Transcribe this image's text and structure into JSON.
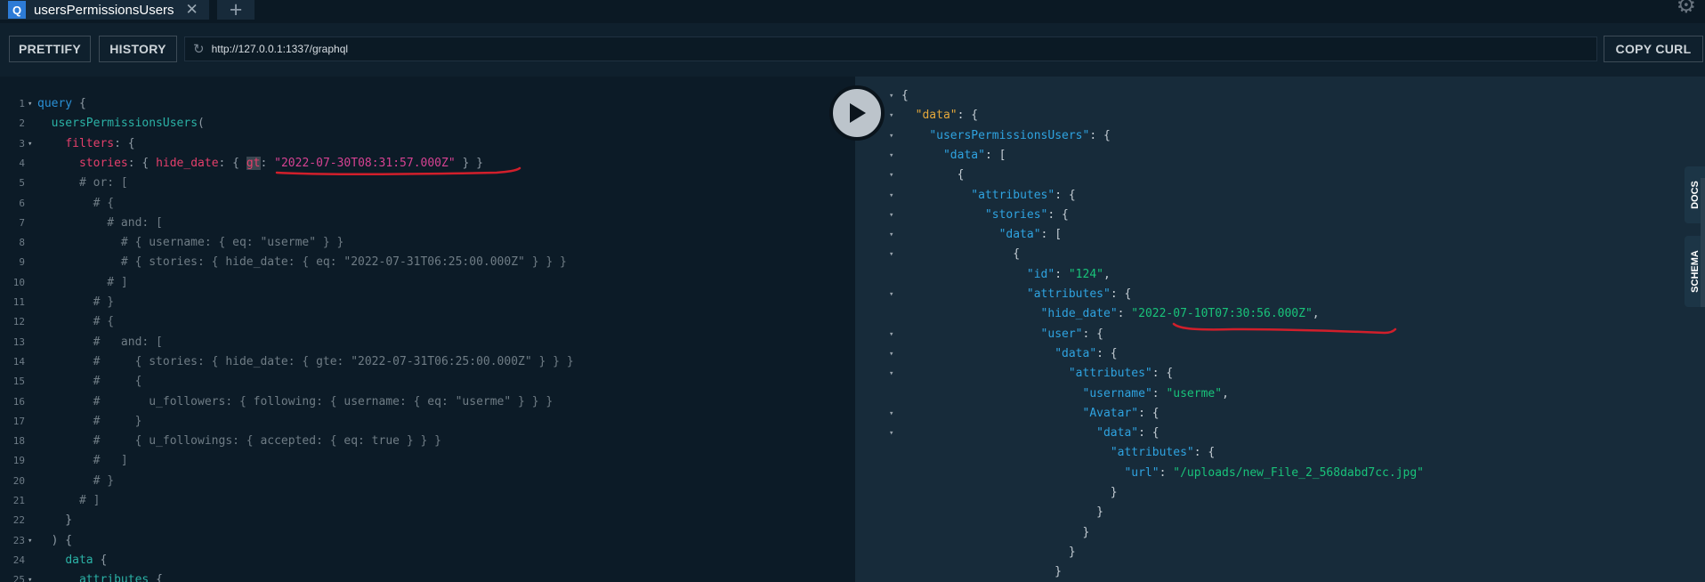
{
  "tab": {
    "icon_letter": "Q",
    "title": "usersPermissionsUsers",
    "close": "✕",
    "add": "+"
  },
  "toolbar": {
    "prettify_label": "PRETTIFY",
    "history_label": "HISTORY",
    "url": "http://127.0.0.1:1337/graphql",
    "copy_curl_label": "COPY CURL"
  },
  "side_tabs": {
    "docs": "DOCS",
    "schema": "SCHEMA"
  },
  "query_lines": [
    {
      "n": "1",
      "fold": true,
      "parts": [
        [
          "kw",
          "query"
        ],
        [
          "pn",
          " {"
        ]
      ]
    },
    {
      "n": "2",
      "fold": false,
      "parts": [
        [
          "pn",
          "  "
        ],
        [
          "field",
          "usersPermissionsUsers"
        ],
        [
          "pn",
          "("
        ]
      ]
    },
    {
      "n": "3",
      "fold": true,
      "parts": [
        [
          "pn",
          "    "
        ],
        [
          "arg",
          "filters"
        ],
        [
          "pn",
          ": {"
        ]
      ]
    },
    {
      "n": "4",
      "fold": false,
      "parts": [
        [
          "pn",
          "      "
        ],
        [
          "arg",
          "stories"
        ],
        [
          "pn",
          ": { "
        ],
        [
          "arg",
          "hide_date"
        ],
        [
          "pn",
          ": { "
        ],
        [
          "arg-hl",
          "gt"
        ],
        [
          "pn",
          ": "
        ],
        [
          "str",
          "\"2022-07-30T08:31:57.000Z\""
        ],
        [
          "pn",
          " } }"
        ]
      ]
    },
    {
      "n": "5",
      "fold": false,
      "parts": [
        [
          "cm",
          "      # or: ["
        ]
      ]
    },
    {
      "n": "6",
      "fold": false,
      "parts": [
        [
          "cm",
          "        # {"
        ]
      ]
    },
    {
      "n": "7",
      "fold": false,
      "parts": [
        [
          "cm",
          "          # and: ["
        ]
      ]
    },
    {
      "n": "8",
      "fold": false,
      "parts": [
        [
          "cm",
          "            # { username: { eq: \"userme\" } }"
        ]
      ]
    },
    {
      "n": "9",
      "fold": false,
      "parts": [
        [
          "cm",
          "            # { stories: { hide_date: { eq: \"2022-07-31T06:25:00.000Z\" } } }"
        ]
      ]
    },
    {
      "n": "10",
      "fold": false,
      "parts": [
        [
          "cm",
          "          # ]"
        ]
      ]
    },
    {
      "n": "11",
      "fold": false,
      "parts": [
        [
          "cm",
          "        # }"
        ]
      ]
    },
    {
      "n": "12",
      "fold": false,
      "parts": [
        [
          "cm",
          "        # {"
        ]
      ]
    },
    {
      "n": "13",
      "fold": false,
      "parts": [
        [
          "cm",
          "        #   and: ["
        ]
      ]
    },
    {
      "n": "14",
      "fold": false,
      "parts": [
        [
          "cm",
          "        #     { stories: { hide_date: { gte: \"2022-07-31T06:25:00.000Z\" } } }"
        ]
      ]
    },
    {
      "n": "15",
      "fold": false,
      "parts": [
        [
          "cm",
          "        #     {"
        ]
      ]
    },
    {
      "n": "16",
      "fold": false,
      "parts": [
        [
          "cm",
          "        #       u_followers: { following: { username: { eq: \"userme\" } } }"
        ]
      ]
    },
    {
      "n": "17",
      "fold": false,
      "parts": [
        [
          "cm",
          "        #     }"
        ]
      ]
    },
    {
      "n": "18",
      "fold": false,
      "parts": [
        [
          "cm",
          "        #     { u_followings: { accepted: { eq: true } } }"
        ]
      ]
    },
    {
      "n": "19",
      "fold": false,
      "parts": [
        [
          "cm",
          "        #   ]"
        ]
      ]
    },
    {
      "n": "20",
      "fold": false,
      "parts": [
        [
          "cm",
          "        # }"
        ]
      ]
    },
    {
      "n": "21",
      "fold": false,
      "parts": [
        [
          "cm",
          "      # ]"
        ]
      ]
    },
    {
      "n": "22",
      "fold": false,
      "parts": [
        [
          "pn",
          "    }"
        ]
      ]
    },
    {
      "n": "23",
      "fold": true,
      "parts": [
        [
          "pn",
          "  ) {"
        ]
      ]
    },
    {
      "n": "24",
      "fold": false,
      "parts": [
        [
          "pn",
          "    "
        ],
        [
          "field",
          "data"
        ],
        [
          "pn",
          " {"
        ]
      ]
    },
    {
      "n": "25",
      "fold": true,
      "parts": [
        [
          "pn",
          "      "
        ],
        [
          "field",
          "attributes"
        ],
        [
          "pn",
          " {"
        ]
      ]
    }
  ],
  "result_lines": [
    {
      "fold": true,
      "parts": [
        [
          "jp",
          "{"
        ]
      ]
    },
    {
      "fold": true,
      "parts": [
        [
          "jp",
          "  "
        ],
        [
          "key-data",
          "\"data\""
        ],
        [
          "jp",
          ": {"
        ]
      ]
    },
    {
      "fold": true,
      "parts": [
        [
          "jp",
          "    "
        ],
        [
          "key",
          "\"usersPermissionsUsers\""
        ],
        [
          "jp",
          ": {"
        ]
      ]
    },
    {
      "fold": true,
      "parts": [
        [
          "jp",
          "      "
        ],
        [
          "key",
          "\"data\""
        ],
        [
          "jp",
          ": ["
        ]
      ]
    },
    {
      "fold": true,
      "parts": [
        [
          "jp",
          "        {"
        ]
      ]
    },
    {
      "fold": true,
      "parts": [
        [
          "jp",
          "          "
        ],
        [
          "key",
          "\"attributes\""
        ],
        [
          "jp",
          ": {"
        ]
      ]
    },
    {
      "fold": true,
      "parts": [
        [
          "jp",
          "            "
        ],
        [
          "key",
          "\"stories\""
        ],
        [
          "jp",
          ": {"
        ]
      ]
    },
    {
      "fold": true,
      "parts": [
        [
          "jp",
          "              "
        ],
        [
          "key",
          "\"data\""
        ],
        [
          "jp",
          ": ["
        ]
      ]
    },
    {
      "fold": true,
      "parts": [
        [
          "jp",
          "                {"
        ]
      ]
    },
    {
      "fold": false,
      "parts": [
        [
          "jp",
          "                  "
        ],
        [
          "key",
          "\"id\""
        ],
        [
          "jp",
          ": "
        ],
        [
          "jstr",
          "\"124\""
        ],
        [
          "jp",
          ","
        ]
      ]
    },
    {
      "fold": true,
      "parts": [
        [
          "jp",
          "                  "
        ],
        [
          "key",
          "\"attributes\""
        ],
        [
          "jp",
          ": {"
        ]
      ]
    },
    {
      "fold": false,
      "parts": [
        [
          "jp",
          "                    "
        ],
        [
          "key",
          "\"hide_date\""
        ],
        [
          "jp",
          ": "
        ],
        [
          "jstr",
          "\"2022-07-10T07:30:56.000Z\""
        ],
        [
          "jp",
          ","
        ]
      ]
    },
    {
      "fold": true,
      "parts": [
        [
          "jp",
          "                    "
        ],
        [
          "key",
          "\"user\""
        ],
        [
          "jp",
          ": {"
        ]
      ]
    },
    {
      "fold": true,
      "parts": [
        [
          "jp",
          "                      "
        ],
        [
          "key",
          "\"data\""
        ],
        [
          "jp",
          ": {"
        ]
      ]
    },
    {
      "fold": true,
      "parts": [
        [
          "jp",
          "                        "
        ],
        [
          "key",
          "\"attributes\""
        ],
        [
          "jp",
          ": {"
        ]
      ]
    },
    {
      "fold": false,
      "parts": [
        [
          "jp",
          "                          "
        ],
        [
          "key",
          "\"username\""
        ],
        [
          "jp",
          ": "
        ],
        [
          "jstr",
          "\"userme\""
        ],
        [
          "jp",
          ","
        ]
      ]
    },
    {
      "fold": true,
      "parts": [
        [
          "jp",
          "                          "
        ],
        [
          "key",
          "\"Avatar\""
        ],
        [
          "jp",
          ": {"
        ]
      ]
    },
    {
      "fold": true,
      "parts": [
        [
          "jp",
          "                            "
        ],
        [
          "key",
          "\"data\""
        ],
        [
          "jp",
          ": {"
        ]
      ]
    },
    {
      "fold": false,
      "parts": [
        [
          "jp",
          "                              "
        ],
        [
          "key",
          "\"attributes\""
        ],
        [
          "jp",
          ": {"
        ]
      ]
    },
    {
      "fold": false,
      "parts": [
        [
          "jp",
          "                                "
        ],
        [
          "key",
          "\"url\""
        ],
        [
          "jp",
          ": "
        ],
        [
          "jstr",
          "\"/uploads/new_File_2_568dabd7cc.jpg\""
        ]
      ]
    },
    {
      "fold": false,
      "parts": [
        [
          "jp",
          "                              }"
        ]
      ]
    },
    {
      "fold": false,
      "parts": [
        [
          "jp",
          "                            }"
        ]
      ]
    },
    {
      "fold": false,
      "parts": [
        [
          "jp",
          "                          }"
        ]
      ]
    },
    {
      "fold": false,
      "parts": [
        [
          "jp",
          "                        }"
        ]
      ]
    },
    {
      "fold": false,
      "parts": [
        [
          "jp",
          "                      }"
        ]
      ]
    }
  ]
}
